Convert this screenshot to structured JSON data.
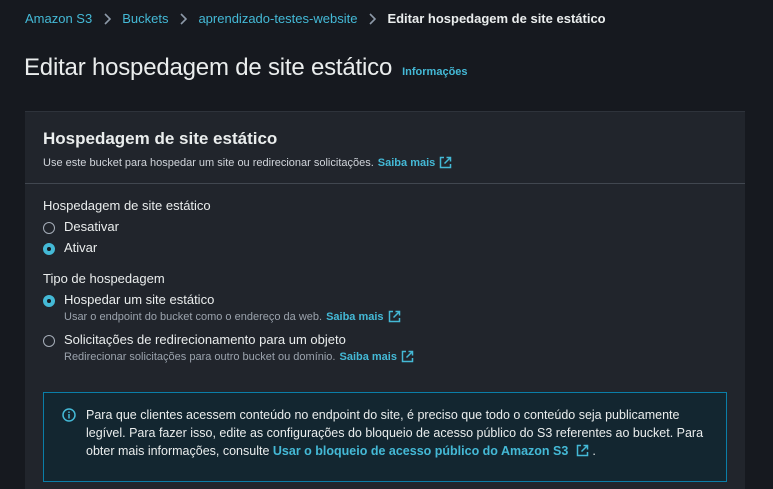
{
  "breadcrumb": {
    "items": [
      "Amazon S3",
      "Buckets",
      "aprendizado-testes-website"
    ],
    "current": "Editar hospedagem de site estático"
  },
  "page": {
    "title": "Editar hospedagem de site estático",
    "info_link": "Informações"
  },
  "section": {
    "title": "Hospedagem de site estático",
    "description": "Use este bucket para hospedar um site ou redirecionar solicitações.",
    "learn_more": "Saiba mais"
  },
  "hosting": {
    "label": "Hospedagem de site estático",
    "options": [
      {
        "label": "Desativar",
        "checked": false
      },
      {
        "label": "Ativar",
        "checked": true
      }
    ]
  },
  "hosting_type": {
    "label": "Tipo de hospedagem",
    "options": [
      {
        "label": "Hospedar um site estático",
        "description": "Usar o endpoint do bucket como o endereço da web.",
        "learn_more": "Saiba mais",
        "checked": true
      },
      {
        "label": "Solicitações de redirecionamento para um objeto",
        "description": "Redirecionar solicitações para outro bucket ou domínio.",
        "learn_more": "Saiba mais",
        "checked": false
      }
    ]
  },
  "alert": {
    "text_line1": "Para que clientes acessem conteúdo no endpoint do site, é preciso que todo o conteúdo seja publicamente",
    "text_line2": "legível. Para fazer isso, edite as configurações do bloqueio de acesso público do S3 referentes ao bucket. Para",
    "text_line3_prefix": "obter mais informações, consulte",
    "link": "Usar o bloqueio de acesso público do Amazon S3",
    "text_line3_suffix": "."
  },
  "colors": {
    "background": "#16191f",
    "link": "#44b9d6",
    "alert_border": "#0a7ea8"
  }
}
